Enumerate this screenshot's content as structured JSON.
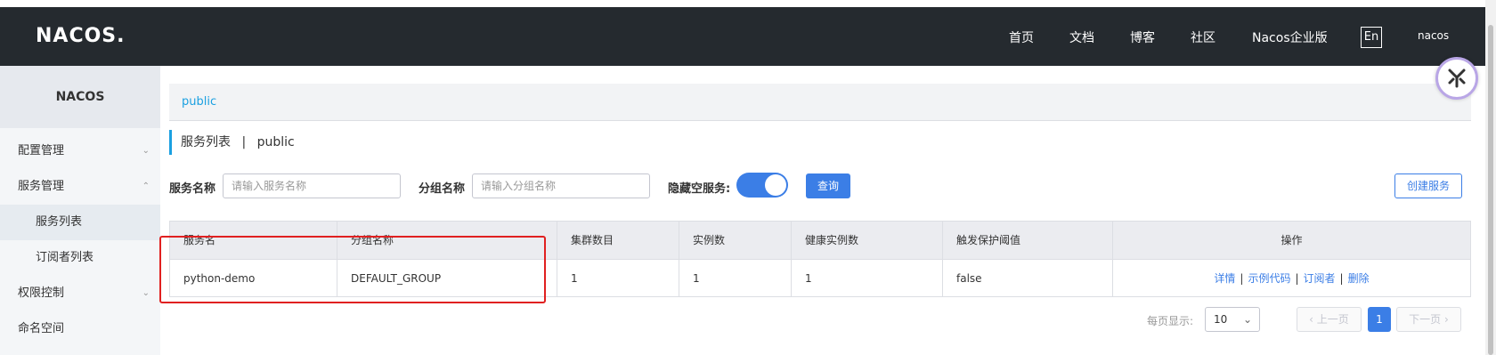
{
  "header": {
    "logo": "NACOS.",
    "nav": [
      "首页",
      "文档",
      "博客",
      "社区",
      "Nacos企业版"
    ],
    "lang": "En",
    "user": "nacos"
  },
  "sidebar": {
    "title": "NACOS",
    "items": [
      {
        "label": "配置管理"
      },
      {
        "label": "服务管理"
      },
      {
        "label": "服务列表"
      },
      {
        "label": "订阅者列表"
      },
      {
        "label": "权限控制"
      },
      {
        "label": "命名空间"
      }
    ]
  },
  "breadcrumb": "public",
  "page_title": {
    "main": "服务列表",
    "sep": "|",
    "ns": "public"
  },
  "filters": {
    "service_label": "服务名称",
    "service_placeholder": "请输入服务名称",
    "group_label": "分组名称",
    "group_placeholder": "请输入分组名称",
    "hide_empty_label": "隐藏空服务:",
    "hide_empty_on": true,
    "query_button": "查询",
    "create_button": "创建服务"
  },
  "table": {
    "columns": [
      "服务名",
      "分组名称",
      "集群数目",
      "实例数",
      "健康实例数",
      "触发保护阈值",
      "操作"
    ],
    "rows": [
      {
        "service": "python-demo",
        "group": "DEFAULT_GROUP",
        "clusters": "1",
        "instances": "1",
        "healthy": "1",
        "protect": "false"
      }
    ],
    "ops": [
      "详情",
      "示例代码",
      "订阅者",
      "删除"
    ]
  },
  "pagination": {
    "per_page_label": "每页显示:",
    "page_size": "10",
    "prev": "上一页",
    "current": "1",
    "next": "下一页"
  }
}
